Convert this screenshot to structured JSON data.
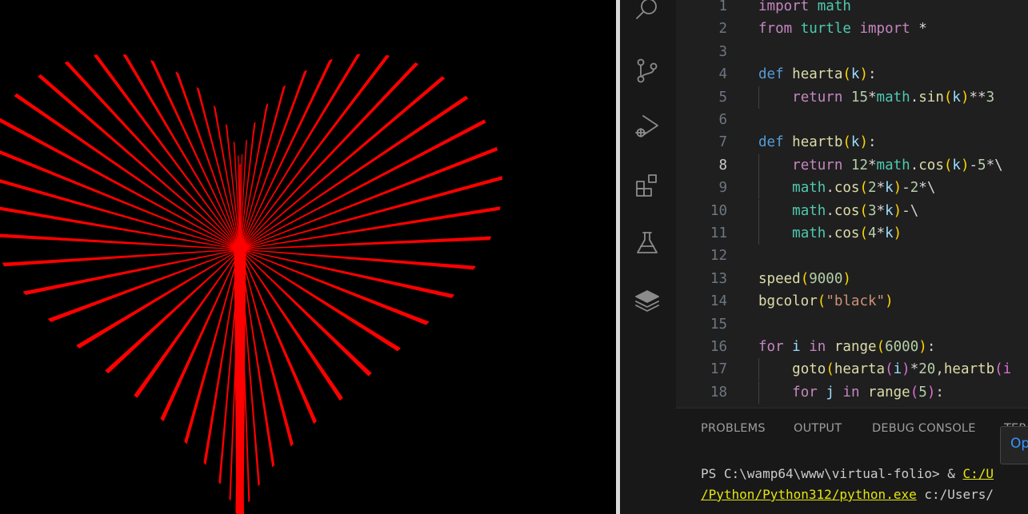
{
  "colors": {
    "turtle_bg": "#000000",
    "heart_stroke": "#ff0000",
    "editor_bg": "#1f1f1f",
    "activity_bg": "#181818"
  },
  "activity_bar": {
    "icons": [
      "search-icon",
      "source-control-icon",
      "run-debug-icon",
      "extensions-icon",
      "testing-icon",
      "layers-icon"
    ]
  },
  "editor": {
    "active_line": 8,
    "lines": [
      {
        "n": "1",
        "indent": false,
        "tokens": [
          [
            "kw",
            "import"
          ],
          [
            "op",
            " "
          ],
          [
            "mod",
            "math"
          ]
        ]
      },
      {
        "n": "2",
        "indent": false,
        "tokens": [
          [
            "kw",
            "from"
          ],
          [
            "op",
            " "
          ],
          [
            "mod",
            "turtle"
          ],
          [
            "op",
            " "
          ],
          [
            "kw",
            "import"
          ],
          [
            "op",
            " *"
          ]
        ]
      },
      {
        "n": "3",
        "indent": false,
        "tokens": []
      },
      {
        "n": "4",
        "indent": false,
        "tokens": [
          [
            "def",
            "def"
          ],
          [
            "op",
            " "
          ],
          [
            "fn",
            "hearta"
          ],
          [
            "p1",
            "("
          ],
          [
            "var",
            "k"
          ],
          [
            "p1",
            ")"
          ],
          [
            "op",
            ":"
          ]
        ]
      },
      {
        "n": "5",
        "indent": true,
        "tokens": [
          [
            "op",
            "    "
          ],
          [
            "kw",
            "return"
          ],
          [
            "op",
            " "
          ],
          [
            "num",
            "15"
          ],
          [
            "op",
            "*"
          ],
          [
            "mod",
            "math"
          ],
          [
            "op",
            "."
          ],
          [
            "fn",
            "sin"
          ],
          [
            "p1",
            "("
          ],
          [
            "var",
            "k"
          ],
          [
            "p1",
            ")"
          ],
          [
            "op",
            "**"
          ],
          [
            "num",
            "3"
          ]
        ]
      },
      {
        "n": "6",
        "indent": false,
        "tokens": []
      },
      {
        "n": "7",
        "indent": false,
        "tokens": [
          [
            "def",
            "def"
          ],
          [
            "op",
            " "
          ],
          [
            "fn",
            "heartb"
          ],
          [
            "p1",
            "("
          ],
          [
            "var",
            "k"
          ],
          [
            "p1",
            ")"
          ],
          [
            "op",
            ":"
          ]
        ]
      },
      {
        "n": "8",
        "indent": true,
        "tokens": [
          [
            "op",
            "    "
          ],
          [
            "kw",
            "return"
          ],
          [
            "op",
            " "
          ],
          [
            "num",
            "12"
          ],
          [
            "op",
            "*"
          ],
          [
            "mod",
            "math"
          ],
          [
            "op",
            "."
          ],
          [
            "fn",
            "cos"
          ],
          [
            "p1",
            "("
          ],
          [
            "var",
            "k"
          ],
          [
            "p1",
            ")"
          ],
          [
            "op",
            "-"
          ],
          [
            "num",
            "5"
          ],
          [
            "op",
            "*\\"
          ]
        ]
      },
      {
        "n": "9",
        "indent": true,
        "tokens": [
          [
            "op",
            "    "
          ],
          [
            "mod",
            "math"
          ],
          [
            "op",
            "."
          ],
          [
            "fn",
            "cos"
          ],
          [
            "p1",
            "("
          ],
          [
            "num",
            "2"
          ],
          [
            "op",
            "*"
          ],
          [
            "var",
            "k"
          ],
          [
            "p1",
            ")"
          ],
          [
            "op",
            "-"
          ],
          [
            "num",
            "2"
          ],
          [
            "op",
            "*\\"
          ]
        ]
      },
      {
        "n": "10",
        "indent": true,
        "tokens": [
          [
            "op",
            "    "
          ],
          [
            "mod",
            "math"
          ],
          [
            "op",
            "."
          ],
          [
            "fn",
            "cos"
          ],
          [
            "p1",
            "("
          ],
          [
            "num",
            "3"
          ],
          [
            "op",
            "*"
          ],
          [
            "var",
            "k"
          ],
          [
            "p1",
            ")"
          ],
          [
            "op",
            "-\\"
          ]
        ]
      },
      {
        "n": "11",
        "indent": true,
        "tokens": [
          [
            "op",
            "    "
          ],
          [
            "mod",
            "math"
          ],
          [
            "op",
            "."
          ],
          [
            "fn",
            "cos"
          ],
          [
            "p1",
            "("
          ],
          [
            "num",
            "4"
          ],
          [
            "op",
            "*"
          ],
          [
            "var",
            "k"
          ],
          [
            "p1",
            ")"
          ]
        ]
      },
      {
        "n": "12",
        "indent": false,
        "tokens": []
      },
      {
        "n": "13",
        "indent": false,
        "tokens": [
          [
            "fn",
            "speed"
          ],
          [
            "p1",
            "("
          ],
          [
            "num",
            "9000"
          ],
          [
            "p1",
            ")"
          ]
        ]
      },
      {
        "n": "14",
        "indent": false,
        "tokens": [
          [
            "fn",
            "bgcolor"
          ],
          [
            "p1",
            "("
          ],
          [
            "str",
            "\"black\""
          ],
          [
            "p1",
            ")"
          ]
        ]
      },
      {
        "n": "15",
        "indent": false,
        "tokens": []
      },
      {
        "n": "16",
        "indent": false,
        "tokens": [
          [
            "kw",
            "for"
          ],
          [
            "op",
            " "
          ],
          [
            "var",
            "i"
          ],
          [
            "op",
            " "
          ],
          [
            "kw",
            "in"
          ],
          [
            "op",
            " "
          ],
          [
            "fn",
            "range"
          ],
          [
            "p1",
            "("
          ],
          [
            "num",
            "6000"
          ],
          [
            "p1",
            ")"
          ],
          [
            "op",
            ":"
          ]
        ]
      },
      {
        "n": "17",
        "indent": true,
        "tokens": [
          [
            "op",
            "    "
          ],
          [
            "fn",
            "goto"
          ],
          [
            "p1",
            "("
          ],
          [
            "fn",
            "hearta"
          ],
          [
            "p2",
            "("
          ],
          [
            "var",
            "i"
          ],
          [
            "p2",
            ")"
          ],
          [
            "op",
            "*"
          ],
          [
            "num",
            "20"
          ],
          [
            "op",
            ","
          ],
          [
            "fn",
            "heartb"
          ],
          [
            "p2",
            "(i"
          ]
        ]
      },
      {
        "n": "18",
        "indent": true,
        "tokens": [
          [
            "op",
            "    "
          ],
          [
            "kw",
            "for"
          ],
          [
            "op",
            " "
          ],
          [
            "var",
            "j"
          ],
          [
            "op",
            " "
          ],
          [
            "kw",
            "in"
          ],
          [
            "op",
            " "
          ],
          [
            "fn",
            "range"
          ],
          [
            "p2",
            "("
          ],
          [
            "num",
            "5"
          ],
          [
            "p2",
            ")"
          ],
          [
            "op",
            ":"
          ]
        ]
      }
    ]
  },
  "panel": {
    "tabs": [
      "PROBLEMS",
      "OUTPUT",
      "DEBUG CONSOLE",
      "TERMI"
    ],
    "tooltip": "Op",
    "terminal": {
      "line1_prefix": "PS C:\\wamp64\\www\\virtual-folio> & ",
      "line1_link": "C:/U",
      "line2_link": "/Python/Python312/python.exe",
      "line2_rest": " c:/Users/"
    }
  }
}
